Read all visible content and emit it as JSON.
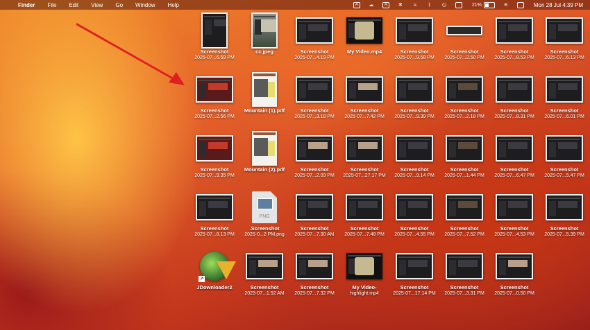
{
  "menubar": {
    "apple_glyph": "",
    "app": "Finder",
    "menus": [
      "File",
      "Edit",
      "View",
      "Go",
      "Window",
      "Help"
    ],
    "status_icons": [
      "font-a-icon",
      "cloud-icon",
      "a-app-icon",
      "fan-icon",
      "sword-icon",
      "bluetooth-icon",
      "history-icon",
      "screen-icon"
    ],
    "battery_percent": "21%",
    "clock": "Mon 28 Jul  4:39 PM"
  },
  "colors": {
    "annotation_arrow": "#e02020"
  },
  "desktop": {
    "items": [
      {
        "line1": "Screenshot",
        "line2": "2025-07...6.59 PM",
        "kind": "screenshot-tall"
      },
      {
        "line1": "cc.jpeg",
        "line2": "",
        "kind": "photo-tall"
      },
      {
        "line1": "Screenshot",
        "line2": "2025-07...4.19 PM",
        "kind": "screenshot"
      },
      {
        "line1": "My Video.mp4",
        "line2": "",
        "kind": "video"
      },
      {
        "line1": "Screenshot",
        "line2": "2025-07...9.58 PM",
        "kind": "screenshot"
      },
      {
        "line1": "Screenshot",
        "line2": "2025-07...2.50 PM",
        "kind": "screenshot-wide"
      },
      {
        "line1": "Screenshot",
        "line2": "2025-07...8.53 PM",
        "kind": "screenshot"
      },
      {
        "line1": "Screenshot",
        "line2": "2025-07...6.13 PM",
        "kind": "screenshot"
      },
      {
        "line1": "Screenshot",
        "line2": "2025-07...2.56 PM",
        "kind": "screenshot-red"
      },
      {
        "line1": "Mountain (1).pdf",
        "line2": "",
        "kind": "pdf"
      },
      {
        "line1": "Screenshot",
        "line2": "2025-07...3.18 PM",
        "kind": "screenshot"
      },
      {
        "line1": "Screenshot",
        "line2": "2025-07...7.42 PM",
        "kind": "screenshot-light"
      },
      {
        "line1": "Screenshot",
        "line2": "2025-07...9.39 PM",
        "kind": "screenshot"
      },
      {
        "line1": "Screenshot",
        "line2": "2025-07...2.18 PM",
        "kind": "screenshot-dark"
      },
      {
        "line1": "Screenshot",
        "line2": "2025-07...8.31 PM",
        "kind": "screenshot"
      },
      {
        "line1": "Screenshot",
        "line2": "2025-07...6.01 PM",
        "kind": "screenshot"
      },
      {
        "line1": "Screenshot",
        "line2": "2025-07...9.35 PM",
        "kind": "screenshot-red"
      },
      {
        "line1": "Mountain (2).pdf",
        "line2": "",
        "kind": "pdf"
      },
      {
        "line1": "Screenshot",
        "line2": "2025-07...2.09 PM",
        "kind": "screenshot-light"
      },
      {
        "line1": "Screenshot",
        "line2": "2025-07...27.17 PM",
        "kind": "screenshot-light"
      },
      {
        "line1": "Screenshot",
        "line2": "2025-07...9.14 PM",
        "kind": "screenshot"
      },
      {
        "line1": "Screenshot",
        "line2": "2025-07...1.44 PM",
        "kind": "screenshot-dark"
      },
      {
        "line1": "Screenshot",
        "line2": "2025-07...6.47 PM",
        "kind": "screenshot"
      },
      {
        "line1": "Screenshot",
        "line2": "2025-07...5.47 PM",
        "kind": "screenshot"
      },
      {
        "line1": "Screenshot",
        "line2": "2025-07...8.13 PM",
        "kind": "screenshot"
      },
      {
        "line1": ".Screenshot",
        "line2": "2025-0...2 PM.png",
        "kind": "png"
      },
      {
        "line1": "Screenshot",
        "line2": "2025-07...7.30 AM",
        "kind": "screenshot"
      },
      {
        "line1": "Screenshot",
        "line2": "2025-07...7.48 PM",
        "kind": "screenshot"
      },
      {
        "line1": "Screenshot",
        "line2": "2025-07...4.55 PM",
        "kind": "screenshot"
      },
      {
        "line1": "Screenshot",
        "line2": "2025-07...7.52 PM",
        "kind": "screenshot-dark"
      },
      {
        "line1": "Screenshot",
        "line2": "2025-07...4.53 PM",
        "kind": "screenshot"
      },
      {
        "line1": "Screenshot",
        "line2": "2025-07...5.39 PM",
        "kind": "screenshot"
      },
      {
        "line1": "JDownloader2",
        "line2": "",
        "kind": "app"
      },
      {
        "line1": "Screenshot",
        "line2": "2025-07...1.52 AM",
        "kind": "screenshot-light"
      },
      {
        "line1": "Screenshot",
        "line2": "2025-07...7.32 PM",
        "kind": "screenshot-light"
      },
      {
        "line1": "My Video-",
        "line2": "highlight.mp4",
        "kind": "video"
      },
      {
        "line1": "Screenshot",
        "line2": "2025-07...17.14 PM",
        "kind": "screenshot"
      },
      {
        "line1": "Screenshot",
        "line2": "2025-07...3.31 PM",
        "kind": "screenshot"
      },
      {
        "line1": "Screenshot",
        "line2": "2025-07...0.50 PM",
        "kind": "screenshot-light"
      }
    ],
    "png_badge": "PNG",
    "alias_glyph": "↗"
  }
}
